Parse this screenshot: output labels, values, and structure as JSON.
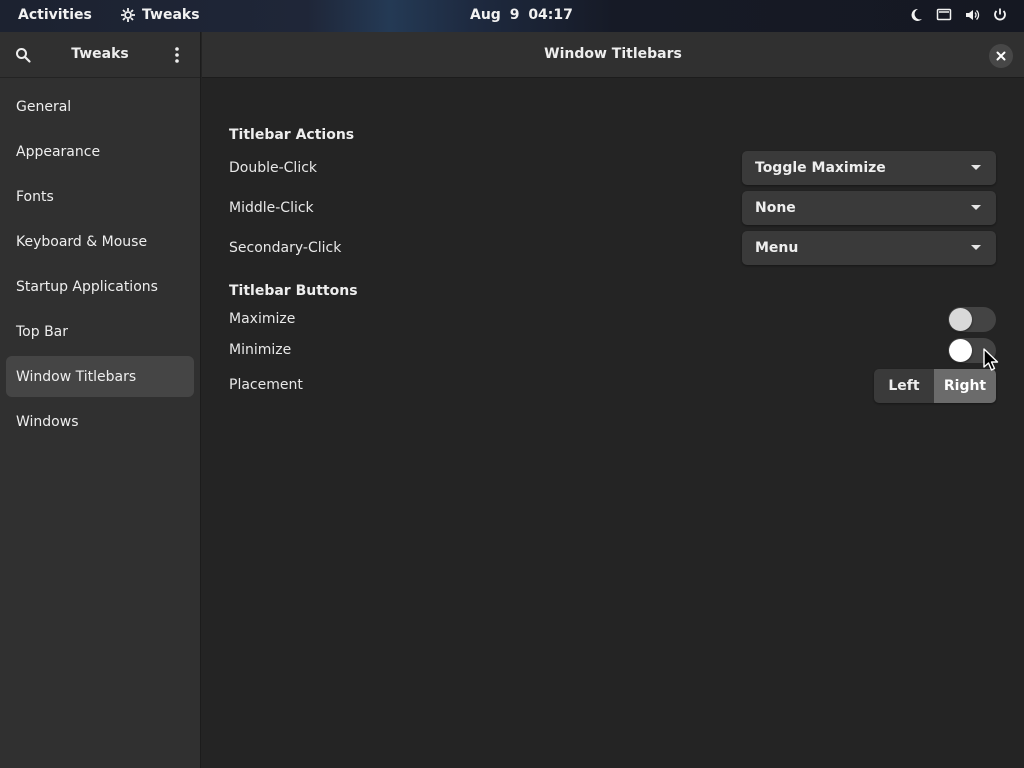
{
  "topbar": {
    "activities": "Activities",
    "app_name": "Tweaks",
    "clock": "Aug 9  04:17",
    "tray_icons": [
      "night-light-icon",
      "display-icon",
      "volume-icon",
      "power-icon"
    ]
  },
  "sidebar": {
    "title": "Tweaks",
    "items": [
      {
        "label": "General"
      },
      {
        "label": "Appearance"
      },
      {
        "label": "Fonts"
      },
      {
        "label": "Keyboard & Mouse"
      },
      {
        "label": "Startup Applications"
      },
      {
        "label": "Top Bar"
      },
      {
        "label": "Window Titlebars",
        "active": true
      },
      {
        "label": "Windows"
      }
    ]
  },
  "main": {
    "title": "Window Titlebars",
    "actions": {
      "heading": "Titlebar Actions",
      "double_click": {
        "label": "Double-Click",
        "value": "Toggle Maximize"
      },
      "middle_click": {
        "label": "Middle-Click",
        "value": "None"
      },
      "secondary_click": {
        "label": "Secondary-Click",
        "value": "Menu"
      }
    },
    "buttons": {
      "heading": "Titlebar Buttons",
      "maximize": {
        "label": "Maximize",
        "enabled": false
      },
      "minimize": {
        "label": "Minimize",
        "enabled": false
      },
      "placement": {
        "label": "Placement",
        "options": [
          "Left",
          "Right"
        ],
        "selected": "Right"
      }
    }
  },
  "colors": {
    "window_bg": "#242424",
    "sidebar_bg": "#303030",
    "active_item": "#454545",
    "selected_segment": "#6b6b6b"
  }
}
